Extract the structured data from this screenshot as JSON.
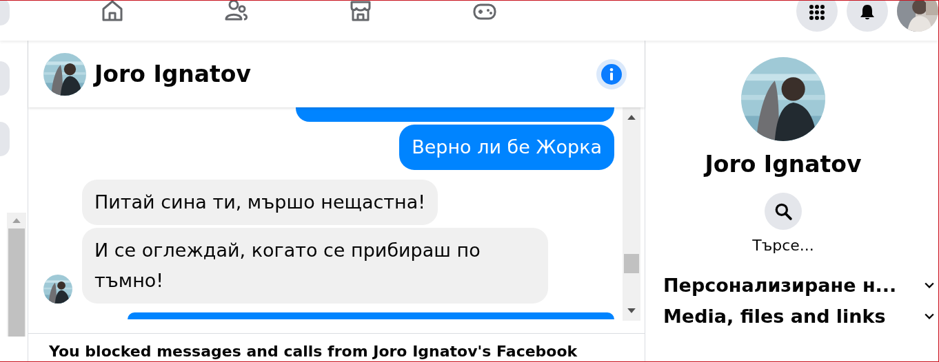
{
  "conversation": {
    "title": "Joro Ignatov",
    "messages": [
      {
        "kind": "outgoing_clipped"
      },
      {
        "kind": "outgoing",
        "text": "Верно ли бе Жорка"
      },
      {
        "kind": "incoming",
        "text": "Питай сина ти, мършо нещастна!",
        "avatar": false
      },
      {
        "kind": "incoming",
        "text": "И се оглеждай, когато се прибираш по тъмно!",
        "avatar": true
      },
      {
        "kind": "outgoing_clipped"
      }
    ],
    "notice": "You blocked messages and calls from Joro Ignatov's Facebook"
  },
  "profile": {
    "name": "Joro Ignatov",
    "search_label": "Търсе...",
    "sections": [
      {
        "title": "Персонализиране н...",
        "expanded": false
      },
      {
        "title": "Media, files and links",
        "expanded": false
      }
    ]
  }
}
